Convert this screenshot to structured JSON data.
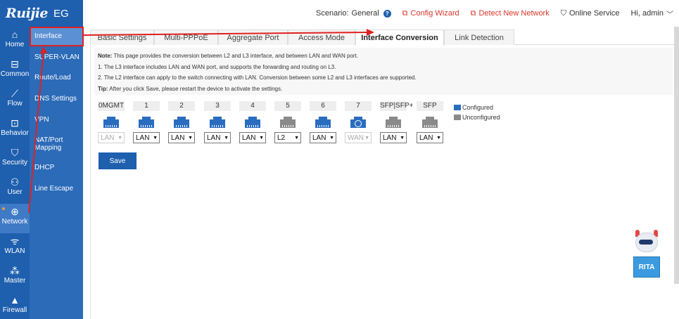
{
  "brand": {
    "logo": "Ruijie",
    "model": "EG"
  },
  "topnav": {
    "scenario_label": "Scenario:",
    "scenario_value": "General",
    "config_wizard": "Config Wizard",
    "detect_network": "Detect New Network",
    "online_service": "Online Service",
    "user": "Hi, admin"
  },
  "mainnav": [
    {
      "label": "Home",
      "icon": "home-icon"
    },
    {
      "label": "Common",
      "icon": "briefcase-icon"
    },
    {
      "label": "Flow",
      "icon": "flow-chart-icon"
    },
    {
      "label": "Behavior",
      "icon": "behavior-icon"
    },
    {
      "label": "Security",
      "icon": "shield-icon"
    },
    {
      "label": "User",
      "icon": "user-icon"
    },
    {
      "label": "Network",
      "icon": "network-globe-icon"
    },
    {
      "label": "WLAN",
      "icon": "wifi-icon"
    },
    {
      "label": "Master",
      "icon": "master-icon"
    },
    {
      "label": "Firewall",
      "icon": "firewall-icon"
    }
  ],
  "subnav": [
    {
      "label": "Interface"
    },
    {
      "label": "SUPER-VLAN"
    },
    {
      "label": "Route/Load"
    },
    {
      "label": "DNS Settings"
    },
    {
      "label": "VPN"
    },
    {
      "label": "NAT/Port Mapping"
    },
    {
      "label": "DHCP"
    },
    {
      "label": "Line Escape"
    }
  ],
  "tabs": [
    {
      "label": "Basic Settings"
    },
    {
      "label": "Multi-PPPoE"
    },
    {
      "label": "Aggregate Port"
    },
    {
      "label": "Access Mode"
    },
    {
      "label": "Interface Conversion"
    },
    {
      "label": "Link Detection"
    }
  ],
  "notice": {
    "note_label": "Note:",
    "note_text": "This page provides the conversion between L2 and L3 interface, and between LAN and WAN port.",
    "line1": "1. The L3 interface includes LAN and WAN port, and supports the forwarding and routing on L3.",
    "line2": "2. The L2 interface can apply to the switch connecting with LAN. Conversion between some L2 and L3 interfaces are supported.",
    "tip_label": "Tip:",
    "tip_text": "After you click Save, please restart the device to activate the settings."
  },
  "ports": [
    {
      "label": "0MGMT",
      "value": "LAN",
      "status": "configured",
      "disabled": true
    },
    {
      "label": "1",
      "value": "LAN",
      "status": "configured",
      "disabled": false
    },
    {
      "label": "2",
      "value": "LAN",
      "status": "configured",
      "disabled": false
    },
    {
      "label": "3",
      "value": "LAN",
      "status": "configured",
      "disabled": false
    },
    {
      "label": "4",
      "value": "LAN",
      "status": "configured",
      "disabled": false
    },
    {
      "label": "5",
      "value": "L2",
      "status": "unconfigured",
      "disabled": false
    },
    {
      "label": "6",
      "value": "LAN",
      "status": "configured",
      "disabled": false
    },
    {
      "label": "7",
      "value": "WAN",
      "status": "wan",
      "disabled": true
    },
    {
      "label": "SFP|SFP+",
      "value": "LAN",
      "status": "unconfigured",
      "disabled": false
    },
    {
      "label": "SFP",
      "value": "LAN",
      "status": "unconfigured",
      "disabled": false
    }
  ],
  "legend": {
    "configured": "Configured",
    "unconfigured": "Unconfigured"
  },
  "save_label": "Save",
  "assistant": {
    "label": "RITA"
  },
  "colors": {
    "primary": "#1e5fae",
    "accent_red": "#d9362b",
    "port_configured": "#2a6dbf",
    "port_unconfigured": "#8a8a8a"
  }
}
